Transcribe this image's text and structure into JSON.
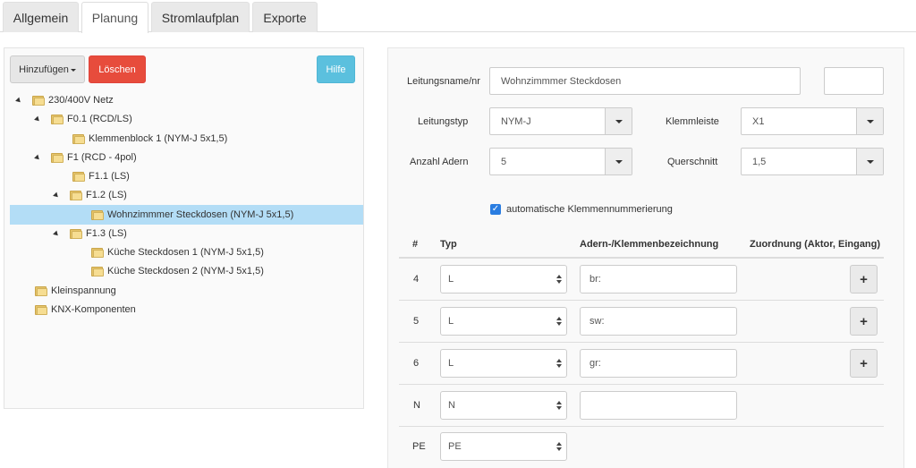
{
  "tabs": [
    {
      "label": "Allgemein"
    },
    {
      "label": "Planung"
    },
    {
      "label": "Stromlaufplan"
    },
    {
      "label": "Exporte"
    }
  ],
  "toolbar": {
    "add_label": "Hinzufügen",
    "delete_label": "Löschen",
    "help_label": "Hilfe"
  },
  "tree": [
    {
      "label": "230/400V Netz"
    },
    {
      "label": "F0.1 (RCD/LS)"
    },
    {
      "label": "Klemmenblock 1 (NYM-J 5x1,5)"
    },
    {
      "label": "F1 (RCD - 4pol)"
    },
    {
      "label": "F1.1 (LS)"
    },
    {
      "label": "F1.2 (LS)"
    },
    {
      "label": "Wohnzimmmer Steckdosen (NYM-J 5x1,5)"
    },
    {
      "label": "F1.3 (LS)"
    },
    {
      "label": "Küche Steckdosen 1 (NYM-J 5x1,5)"
    },
    {
      "label": "Küche Steckdosen 2 (NYM-J 5x1,5)"
    },
    {
      "label": "Kleinspannung"
    },
    {
      "label": "KNX-Komponenten"
    }
  ],
  "form": {
    "leitungsname_label": "Leitungsname/nr",
    "leitungsname_value": "Wohnzimmmer Steckdosen",
    "extra_value": "",
    "leitungstyp_label": "Leitungstyp",
    "leitungstyp_value": "NYM-J",
    "klemmleiste_label": "Klemmleiste",
    "klemmleiste_value": "X1",
    "adern_label": "Anzahl Adern",
    "adern_value": "5",
    "querschnitt_label": "Querschnitt",
    "querschnitt_value": "1,5",
    "auto_label": "automatische Klemmennummerierung"
  },
  "table": {
    "headers": {
      "num": "#",
      "typ": "Typ",
      "bez": "Adern-/Klemmenbezeichnung",
      "zuord": "Zuordnung (Aktor, Eingang)"
    },
    "rows": [
      {
        "num": "4",
        "typ": "L",
        "bez": "br:",
        "plus": "+"
      },
      {
        "num": "5",
        "typ": "L",
        "bez": "sw:",
        "plus": "+"
      },
      {
        "num": "6",
        "typ": "L",
        "bez": "gr:",
        "plus": "+"
      },
      {
        "num": "N",
        "typ": "N",
        "bez": ""
      },
      {
        "num": "PE",
        "typ": "PE"
      }
    ]
  },
  "colors": {
    "danger": "#e74c3c",
    "info": "#5bc0de",
    "selection": "#b3ddf6",
    "checkbox": "#2a7de1"
  }
}
